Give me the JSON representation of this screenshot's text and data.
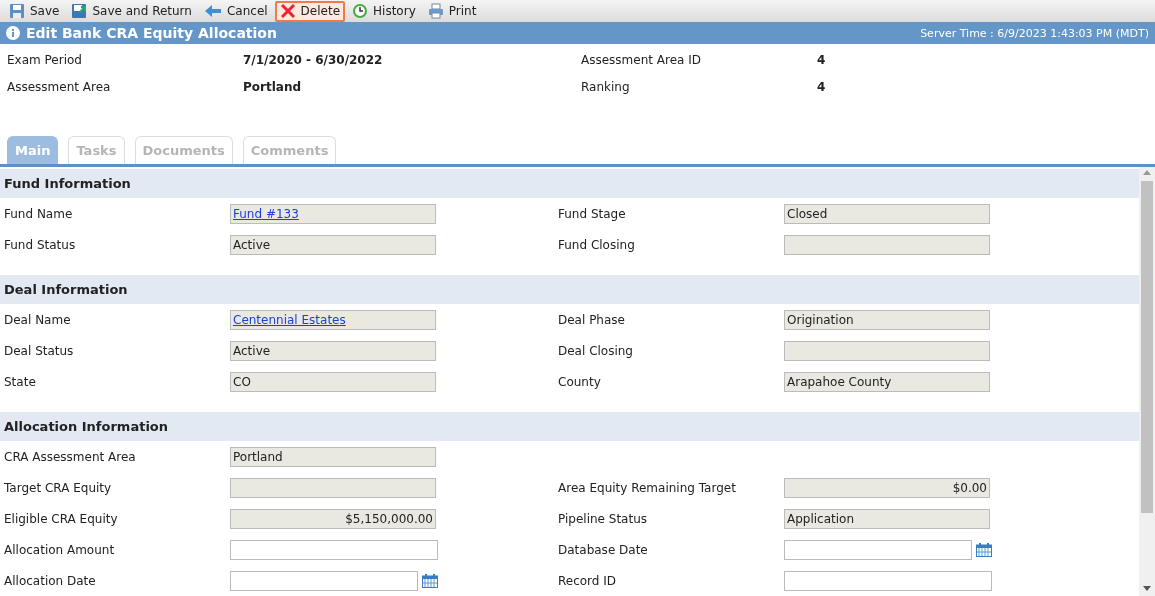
{
  "toolbar": [
    {
      "kind": "save",
      "label": "Save",
      "focused": false
    },
    {
      "kind": "save-return",
      "label": "Save and Return",
      "focused": false
    },
    {
      "kind": "cancel",
      "label": "Cancel",
      "focused": false
    },
    {
      "kind": "delete",
      "label": "Delete",
      "focused": true
    },
    {
      "kind": "history",
      "label": "History",
      "focused": false
    },
    {
      "kind": "print",
      "label": "Print",
      "focused": false
    }
  ],
  "title_bar": {
    "title": "Edit Bank CRA Equity Allocation",
    "server_time": "Server Time : 6/9/2023 1:43:03 PM (MDT)"
  },
  "summary": [
    {
      "label": "Exam Period",
      "value": "7/1/2020 - 6/30/2022"
    },
    {
      "label": "Assessment Area ID",
      "value": "4"
    },
    {
      "label": "Assessment Area",
      "value": "Portland"
    },
    {
      "label": "Ranking",
      "value": "4"
    }
  ],
  "tabs": [
    {
      "label": "Main",
      "selected": true
    },
    {
      "label": "Tasks",
      "selected": false
    },
    {
      "label": "Documents",
      "selected": false
    },
    {
      "label": "Comments",
      "selected": false
    }
  ],
  "sections": [
    {
      "title": "Fund Information",
      "rows": [
        [
          {
            "label": "Fund Name",
            "kind": "link",
            "value": "Fund #133"
          },
          {
            "label": "Fund Stage",
            "kind": "text",
            "value": "Closed"
          }
        ],
        [
          {
            "label": "Fund Status",
            "kind": "text",
            "value": "Active"
          },
          {
            "label": "Fund Closing",
            "kind": "text"
          }
        ]
      ]
    },
    {
      "title": "Deal Information",
      "rows": [
        [
          {
            "label": "Deal Name",
            "kind": "link",
            "value": "Centennial Estates"
          },
          {
            "label": "Deal Phase",
            "kind": "text",
            "value": "Origination"
          }
        ],
        [
          {
            "label": "Deal Status",
            "kind": "text",
            "value": "Active"
          },
          {
            "label": "Deal Closing",
            "kind": "text"
          }
        ],
        [
          {
            "label": "State",
            "kind": "text",
            "value": "CO"
          },
          {
            "label": "County",
            "kind": "text",
            "value": "Arapahoe County"
          }
        ]
      ]
    },
    {
      "title": "Allocation Information",
      "rows": [
        [
          {
            "label": "CRA Assessment Area",
            "kind": "text",
            "value": "Portland"
          }
        ],
        [
          {
            "label": "Target CRA Equity",
            "kind": "amount"
          },
          {
            "label": "Area Equity Remaining Target",
            "kind": "amount",
            "value": "$0.00"
          }
        ],
        [
          {
            "label": "Eligible CRA Equity",
            "kind": "amount",
            "value": "$5,150,000.00"
          },
          {
            "label": "Pipeline Status",
            "kind": "text",
            "value": "Application"
          }
        ],
        [
          {
            "label": "Allocation Amount",
            "kind": "input"
          },
          {
            "label": "Database Date",
            "kind": "date"
          }
        ],
        [
          {
            "label": "Allocation Date",
            "kind": "date"
          },
          {
            "label": "Record ID",
            "kind": "input"
          }
        ]
      ]
    }
  ]
}
